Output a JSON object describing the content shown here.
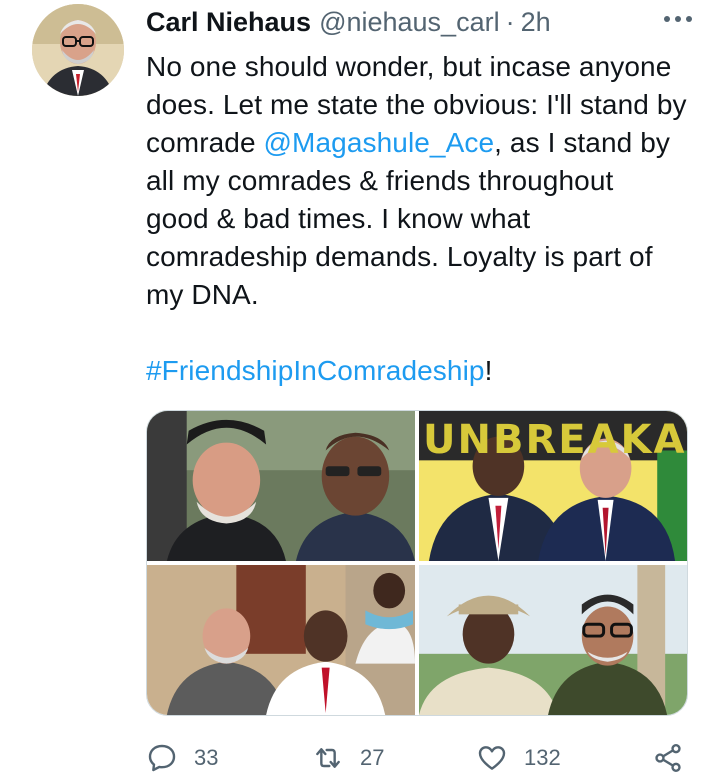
{
  "tweet": {
    "author_name": "Carl Niehaus",
    "author_handle": "@niehaus_carl",
    "separator": "·",
    "timestamp": "2h",
    "text": {
      "line1": "No one should wonder, but incase anyone",
      "line2": "does. Let me state the obvious: I'll stand by",
      "line3_pre": "comrade ",
      "mention": "@Magashule_Ace",
      "line3_post": ", as I stand by",
      "line4": "all my comrades & friends throughout",
      "line5": "good & bad times. I know what",
      "line6": "comradeship demands. Loyalty is part of",
      "line7": "my DNA.",
      "hashtag": "#FriendshipInComradeship",
      "hashtag_suffix": "!"
    },
    "photo_banner_text": "UNBREAKA",
    "stats": {
      "replies": "33",
      "retweets": "27",
      "likes": "132"
    },
    "icons": {
      "reply": "reply-icon",
      "retweet": "retweet-icon",
      "like": "heart-icon",
      "share": "share-icon",
      "more": "more-dots-icon"
    },
    "colors": {
      "link": "#1d9bf0",
      "secondary_text": "#536471",
      "primary_text": "#0f1419"
    }
  }
}
